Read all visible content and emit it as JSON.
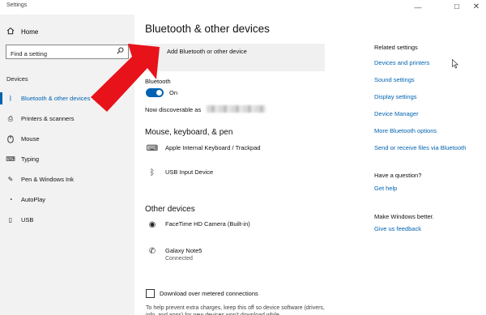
{
  "window": {
    "title": "Settings",
    "minimize_glyph": "—",
    "maximize_glyph": "☐",
    "close_glyph": "✕"
  },
  "sidebar": {
    "home_icon": "home-icon",
    "home_label": "Home",
    "search": {
      "placeholder": "Find a setting",
      "icon": "search-icon"
    },
    "category": "Devices",
    "items": [
      {
        "label": "Bluetooth & other devices",
        "icon": "bluetooth-icon",
        "glyph": "ᛒ",
        "active": true
      },
      {
        "label": "Printers & scanners",
        "icon": "printer-icon",
        "glyph": "⎙",
        "active": false
      },
      {
        "label": "Mouse",
        "icon": "mouse-icon",
        "glyph": "🖱",
        "active": false
      },
      {
        "label": "Typing",
        "icon": "keyboard-icon",
        "glyph": "⌨",
        "active": false
      },
      {
        "label": "Pen & Windows Ink",
        "icon": "pen-icon",
        "glyph": "✎",
        "active": false
      },
      {
        "label": "AutoPlay",
        "icon": "autoplay-icon",
        "glyph": "◔",
        "active": false
      },
      {
        "label": "USB",
        "icon": "usb-icon",
        "glyph": "▯",
        "active": false
      }
    ]
  },
  "main": {
    "title": "Bluetooth & other devices",
    "add_button": {
      "label": "Add Bluetooth or other device",
      "glyph": "+"
    },
    "bluetooth_label": "Bluetooth",
    "toggle_state": "On",
    "discoverable_label": "Now discoverable as",
    "mouse_section": {
      "heading": "Mouse, keyboard, & pen",
      "devices": [
        {
          "name": "Apple Internal Keyboard / Trackpad",
          "icon": "keyboard-icon",
          "glyph": "⌨"
        },
        {
          "name": "USB Input Device",
          "icon": "bluetooth-icon",
          "glyph": "ᛒ"
        }
      ]
    },
    "other_section": {
      "heading": "Other devices",
      "devices": [
        {
          "name": "FaceTime HD Camera (Built-in)",
          "status": "",
          "icon": "camera-icon",
          "glyph": "◉"
        },
        {
          "name": "Galaxy Note5",
          "status": "Connected",
          "icon": "phone-icon",
          "glyph": "✆"
        }
      ]
    },
    "metered_checkbox_label": "Download over metered connections",
    "metered_help": "To help prevent extra charges, keep this off so device software (drivers, info, and apps) for new devices won't download while"
  },
  "related": {
    "heading": "Related settings",
    "links": [
      "Devices and printers",
      "Sound settings",
      "Display settings",
      "Device Manager",
      "More Bluetooth options",
      "Send or receive files via Bluetooth"
    ],
    "question_heading": "Have a question?",
    "question_link": "Get help",
    "better_heading": "Make Windows better.",
    "better_link": "Give us feedback"
  },
  "colors": {
    "accent": "#0063b1",
    "sidebar_bg": "#f2f2f2",
    "arrow": "#e8121a"
  }
}
